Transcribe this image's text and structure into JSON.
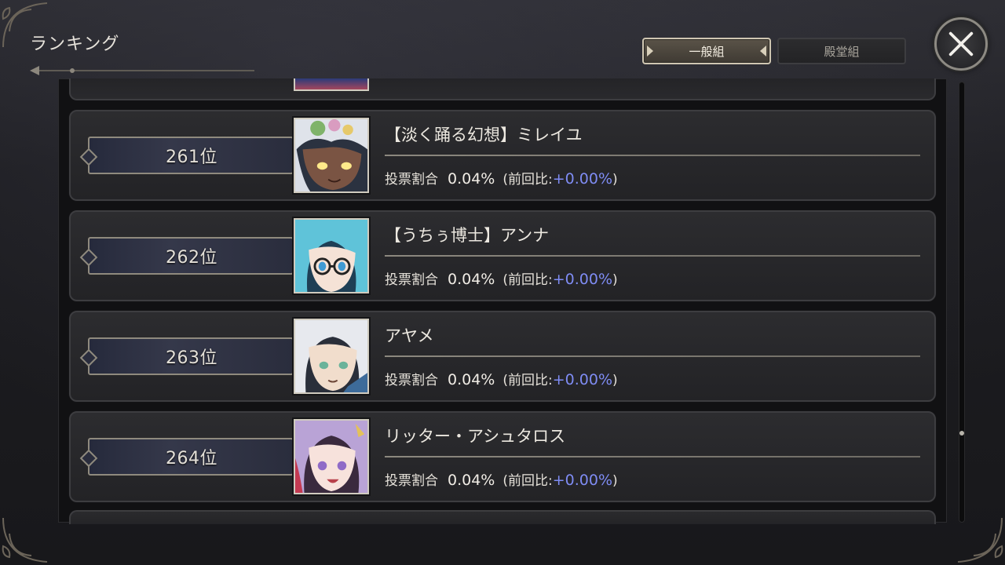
{
  "screen": {
    "title": "ランキング"
  },
  "tabs": [
    {
      "label": "一般組",
      "selected": true
    },
    {
      "label": "殿堂組",
      "selected": false
    }
  ],
  "close_button": {
    "icon": "close-icon"
  },
  "stat_label": "投票割合",
  "prev_label_open": "(前回比:",
  "prev_label_close": ")",
  "colors": {
    "delta": "#7f8cf4",
    "rank_plate": "#2a2d3d"
  },
  "rows": [
    {
      "rank": "261位",
      "name": "【淡く踊る幻想】ミレイユ",
      "share": "0.04%",
      "delta": "+0.00%",
      "portrait_icon": "character-portrait-icon"
    },
    {
      "rank": "262位",
      "name": "【うちぅ博士】アンナ",
      "share": "0.04%",
      "delta": "+0.00%",
      "portrait_icon": "character-portrait-icon"
    },
    {
      "rank": "263位",
      "name": "アヤメ",
      "share": "0.04%",
      "delta": "+0.00%",
      "portrait_icon": "character-portrait-icon"
    },
    {
      "rank": "264位",
      "name": "リッター・アシュタロス",
      "share": "0.04%",
      "delta": "+0.00%",
      "portrait_icon": "character-portrait-icon"
    }
  ],
  "scroll": {
    "position_fraction": 0.8
  }
}
